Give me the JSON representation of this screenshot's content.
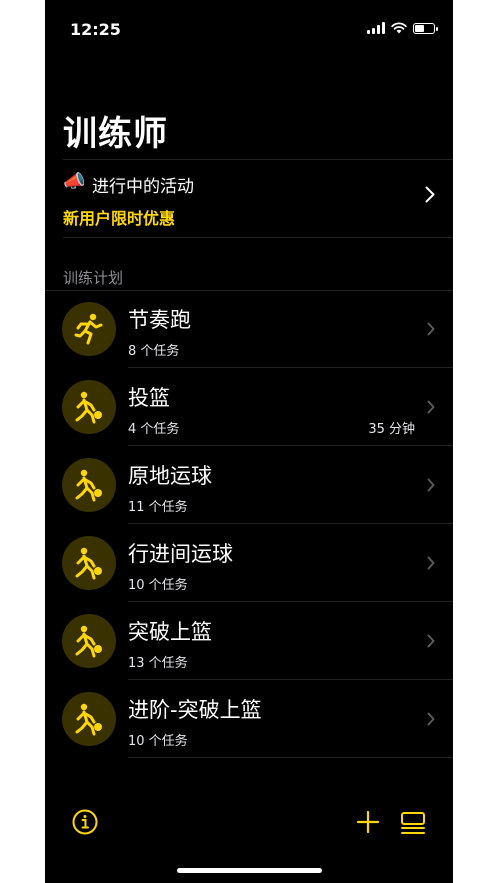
{
  "status_bar": {
    "time": "12:25",
    "battery_level_fraction": 0.5
  },
  "page": {
    "title": "训练师"
  },
  "promo": {
    "icon": "megaphone-icon",
    "icon_glyph": "📣",
    "title": "进行中的活动",
    "subtitle": "新用户限时优惠",
    "accent_color": "#FFD60A"
  },
  "section": {
    "header": "训练计划"
  },
  "plans": [
    {
      "title": "节奏跑",
      "count": "8 个任务",
      "duration": "",
      "icon": "running-icon"
    },
    {
      "title": "投篮",
      "count": "4 个任务",
      "duration": "35 分钟",
      "icon": "basketball-dribble-icon"
    },
    {
      "title": "原地运球",
      "count": "11 个任务",
      "duration": "",
      "icon": "basketball-dribble-icon"
    },
    {
      "title": "行进间运球",
      "count": "10 个任务",
      "duration": "",
      "icon": "basketball-dribble-icon"
    },
    {
      "title": "突破上篮",
      "count": "13 个任务",
      "duration": "",
      "icon": "basketball-dribble-icon"
    },
    {
      "title": "进阶-突破上篮",
      "count": "10 个任务",
      "duration": "",
      "icon": "basketball-dribble-icon"
    }
  ],
  "toolbar": {
    "info_icon": "info-icon",
    "add_icon": "plus-icon",
    "list_icon": "list-icon"
  },
  "colors": {
    "background": "#000000",
    "accent": "#FFD60A",
    "icon_circle": "#3a3100",
    "secondary_text": "#8e8e93"
  }
}
